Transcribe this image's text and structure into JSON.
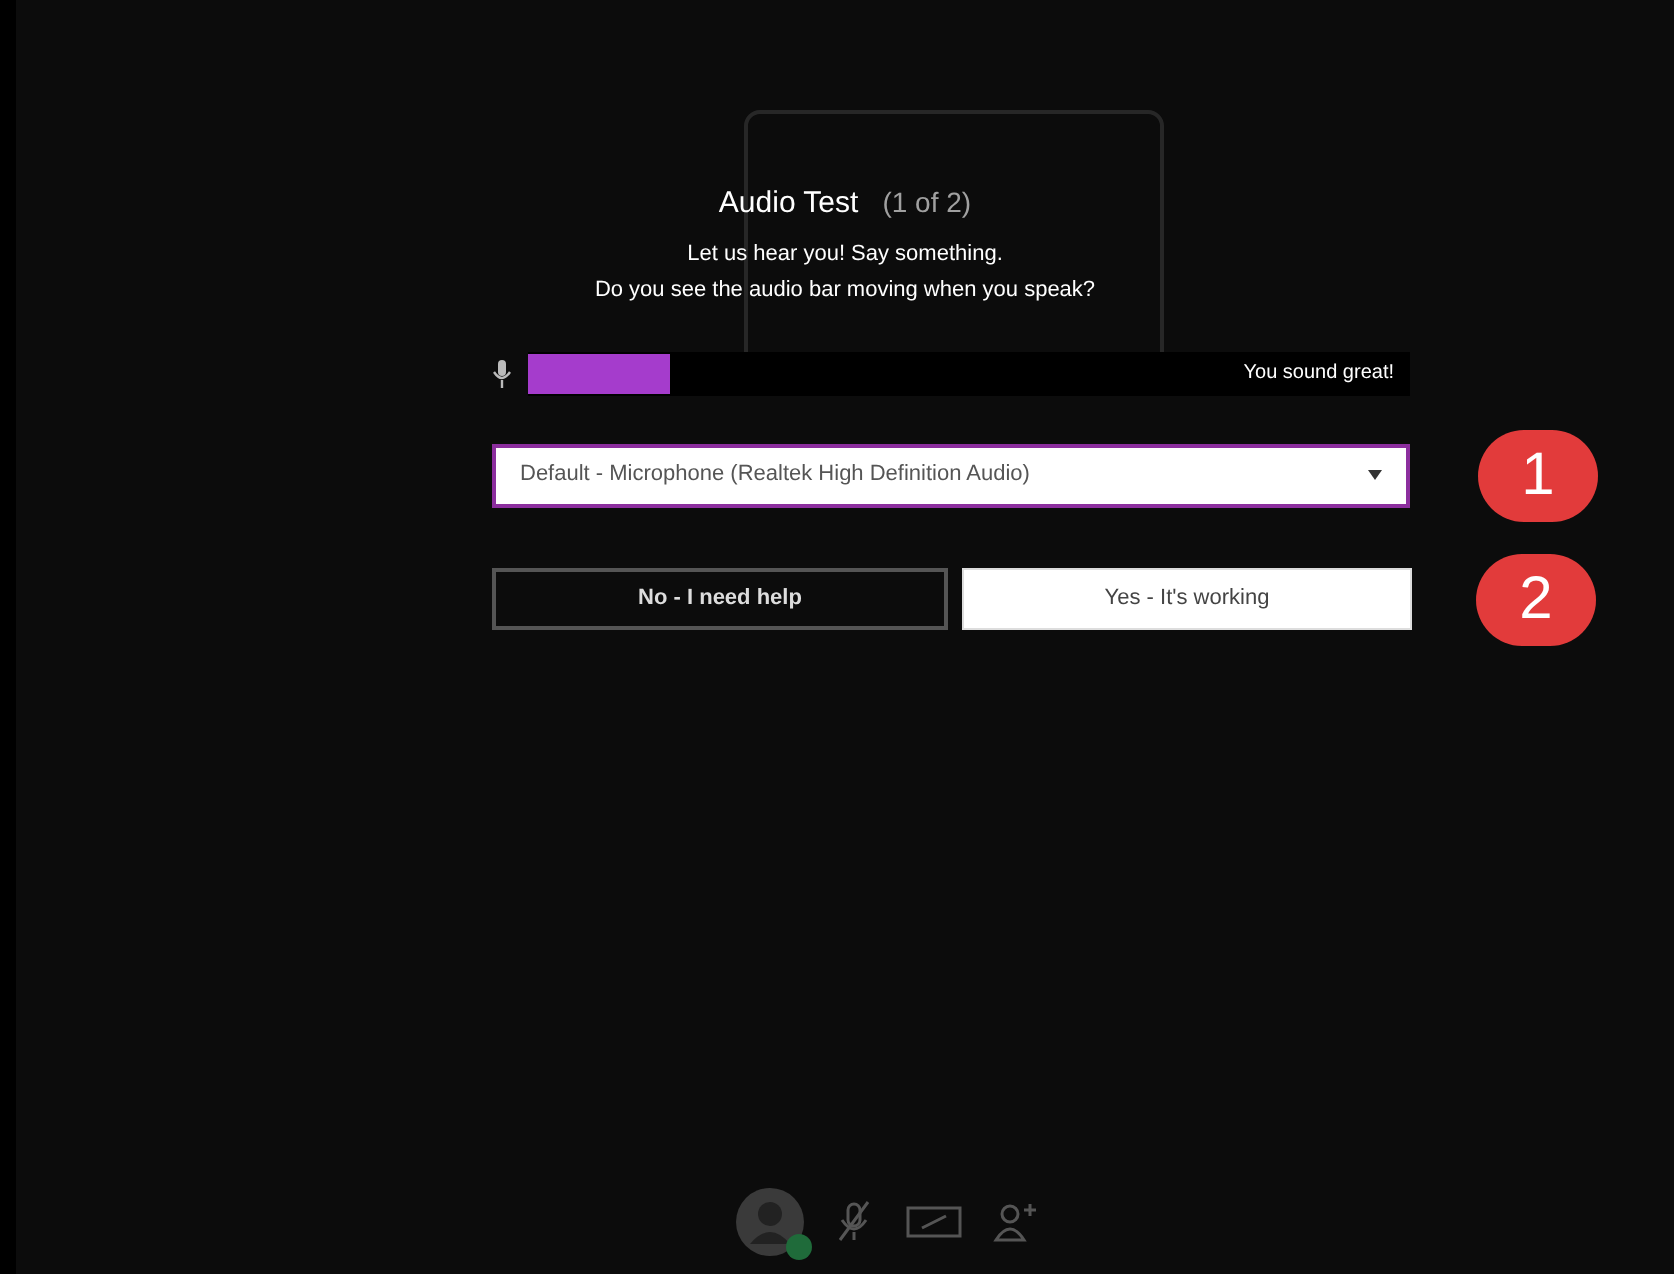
{
  "dialog": {
    "title": "Audio Test",
    "step": "(1 of 2)",
    "instructions": [
      "Let us hear you! Say something.",
      "Do you see the audio bar moving when you speak?"
    ]
  },
  "meter": {
    "level": 0.16,
    "reading": "You sound great!"
  },
  "microphone_select": {
    "value": "Default - Microphone (Realtek High Definition Audio)"
  },
  "buttons": [
    {
      "label": "No - I need help",
      "kind": "secondary"
    },
    {
      "label": "Yes - It's working",
      "kind": "primary"
    }
  ],
  "callouts": [
    "1",
    "2"
  ],
  "toolbar": [
    {
      "kind": "avatar",
      "online": true
    },
    {
      "kind": "mic-off"
    },
    {
      "kind": "screen"
    },
    {
      "kind": "add-person"
    }
  ]
}
